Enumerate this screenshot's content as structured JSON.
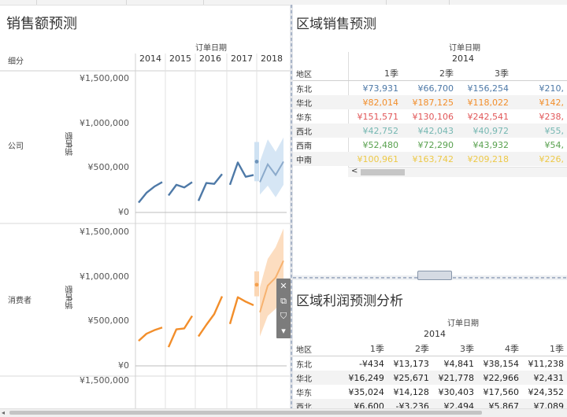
{
  "colors": {
    "company": "#4e79a7",
    "consumer": "#f28e2b",
    "east_north": "#4e79a7",
    "north": "#f28e2b",
    "east": "#e15759",
    "west": "#76b7b2",
    "southwest": "#59a14f",
    "central_south": "#edc948",
    "forecast_band_company": "#cfe2f3",
    "forecast_band_consumer": "#fbd7b5"
  },
  "left": {
    "title": "销售额预测",
    "date_header": "订单日期",
    "segment_header": "细分",
    "measure_label": "销售额",
    "y_ticks": [
      "¥1,500,000",
      "¥1,000,000",
      "¥500,000",
      "¥0"
    ],
    "y_tick_values": [
      1500000,
      1000000,
      500000,
      0
    ],
    "segments": [
      {
        "name": "公司"
      },
      {
        "name": "消费者"
      }
    ]
  },
  "chart_data": {
    "type": "line",
    "x_unit": "季度",
    "years": [
      "2014",
      "2015",
      "2016",
      "2017",
      "2018"
    ],
    "ylim": [
      0,
      1500000
    ],
    "series": [
      {
        "name": "公司",
        "actual": [
          [
            110000,
            220000,
            290000,
            340000
          ],
          [
            190000,
            310000,
            280000,
            340000
          ],
          [
            130000,
            330000,
            320000,
            430000
          ],
          [
            310000,
            560000,
            400000,
            420000
          ]
        ],
        "forecast_point": 570000,
        "forecast_point_band": [
          350000,
          790000
        ],
        "forecast": [
          340000,
          540000,
          420000,
          570000
        ],
        "forecast_lower": [
          200000,
          300000,
          170000,
          310000
        ],
        "forecast_upper": [
          570000,
          820000,
          680000,
          840000
        ]
      },
      {
        "name": "消费者",
        "actual": [
          [
            280000,
            360000,
            400000,
            430000
          ],
          [
            210000,
            410000,
            420000,
            560000
          ],
          [
            330000,
            460000,
            580000,
            780000
          ],
          [
            470000,
            770000,
            720000,
            680000
          ]
        ],
        "forecast_point": 910000,
        "forecast_point_band": [
          780000,
          1060000
        ],
        "forecast": [
          600000,
          900000,
          990000,
          1180000
        ],
        "forecast_lower": [
          330000,
          560000,
          640000,
          790000
        ],
        "forecast_upper": [
          880000,
          1200000,
          1330000,
          1540000
        ]
      }
    ]
  },
  "sales_table": {
    "title": "区域销售预测",
    "date_header": "订单日期",
    "year": "2014",
    "row_header": "地区",
    "quarters": [
      "1季",
      "2季",
      "3季",
      ""
    ],
    "rows": [
      {
        "region": "东北",
        "color": "#4e79a7",
        "values": [
          "¥73,931",
          "¥66,700",
          "¥156,254",
          "¥210,"
        ]
      },
      {
        "region": "华北",
        "color": "#f28e2b",
        "values": [
          "¥82,014",
          "¥187,125",
          "¥118,022",
          "¥142,"
        ]
      },
      {
        "region": "华东",
        "color": "#e15759",
        "values": [
          "¥151,571",
          "¥130,106",
          "¥242,541",
          "¥238,"
        ]
      },
      {
        "region": "西北",
        "color": "#76b7b2",
        "values": [
          "¥42,752",
          "¥42,043",
          "¥40,972",
          "¥55,"
        ]
      },
      {
        "region": "西南",
        "color": "#59a14f",
        "values": [
          "¥52,480",
          "¥72,290",
          "¥43,932",
          "¥54,"
        ]
      },
      {
        "region": "中南",
        "color": "#edc948",
        "values": [
          "¥100,961",
          "¥163,742",
          "¥209,218",
          "¥226,"
        ]
      }
    ]
  },
  "profit_table": {
    "title": "区域利润预测分析",
    "date_header": "订单日期",
    "year": "2014",
    "row_header": "地区",
    "quarters": [
      "1季",
      "2季",
      "3季",
      "4季",
      "1季"
    ],
    "rows": [
      {
        "region": "东北",
        "values": [
          "-¥434",
          "¥13,173",
          "¥4,841",
          "¥38,154",
          "¥11,238"
        ]
      },
      {
        "region": "华北",
        "values": [
          "¥16,249",
          "¥25,671",
          "¥21,778",
          "¥22,966",
          "¥2,431"
        ]
      },
      {
        "region": "华东",
        "values": [
          "¥35,024",
          "¥14,128",
          "¥30,403",
          "¥17,560",
          "¥24,352"
        ]
      },
      {
        "region": "西北",
        "values": [
          "¥6,600",
          "-¥3,236",
          "¥2,494",
          "¥5,867",
          "¥7,089"
        ]
      }
    ]
  },
  "toolbar": {
    "icons": [
      "close-icon",
      "popout-icon",
      "filter-icon",
      "dropdown-icon"
    ],
    "glyphs": [
      "✕",
      "⧉",
      "⛉",
      "▾"
    ]
  }
}
